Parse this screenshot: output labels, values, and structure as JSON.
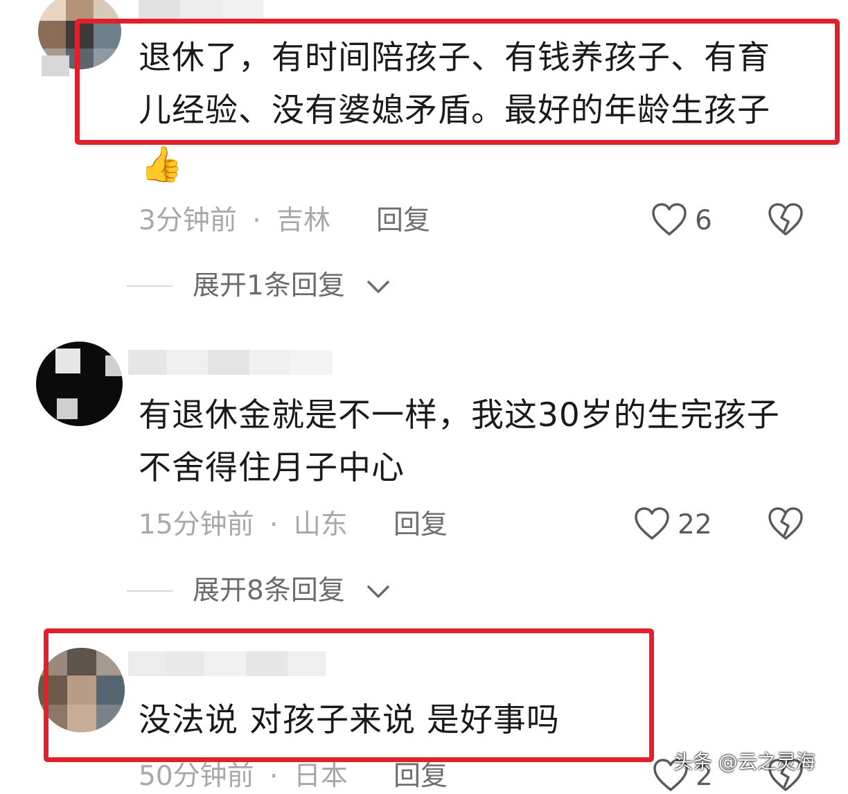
{
  "comments": [
    {
      "text_lines": [
        "退休了，有时间陪孩子、有钱养孩子、有育",
        "儿经验、没有婆媳矛盾。最好的年龄生孩子"
      ],
      "emoji": "👍",
      "time": "3分钟前",
      "location": "吉林",
      "reply_label": "回复",
      "likes": "6",
      "expand": "展开1条回复",
      "highlighted": true
    },
    {
      "text_lines": [
        "有退休金就是不一样，我这30岁的生完孩子",
        "不舍得住月子中心"
      ],
      "time": "15分钟前",
      "location": "山东",
      "reply_label": "回复",
      "likes": "22",
      "expand": "展开8条回复",
      "highlighted": false
    },
    {
      "text_lines": [
        "没法说 对孩子来说 是好事吗"
      ],
      "time": "50分钟前",
      "location": "日本",
      "reply_label": "回复",
      "likes": "2",
      "highlighted": true
    }
  ],
  "separator": "·",
  "watermark": "头条 @云之灵海",
  "icons": {
    "like": "heart-outline-icon",
    "dislike": "broken-heart-icon",
    "expand": "chevron-down-icon"
  },
  "colors": {
    "highlight": "#e0202a",
    "meta": "#a8a8a8",
    "text": "#1a1a1a"
  }
}
